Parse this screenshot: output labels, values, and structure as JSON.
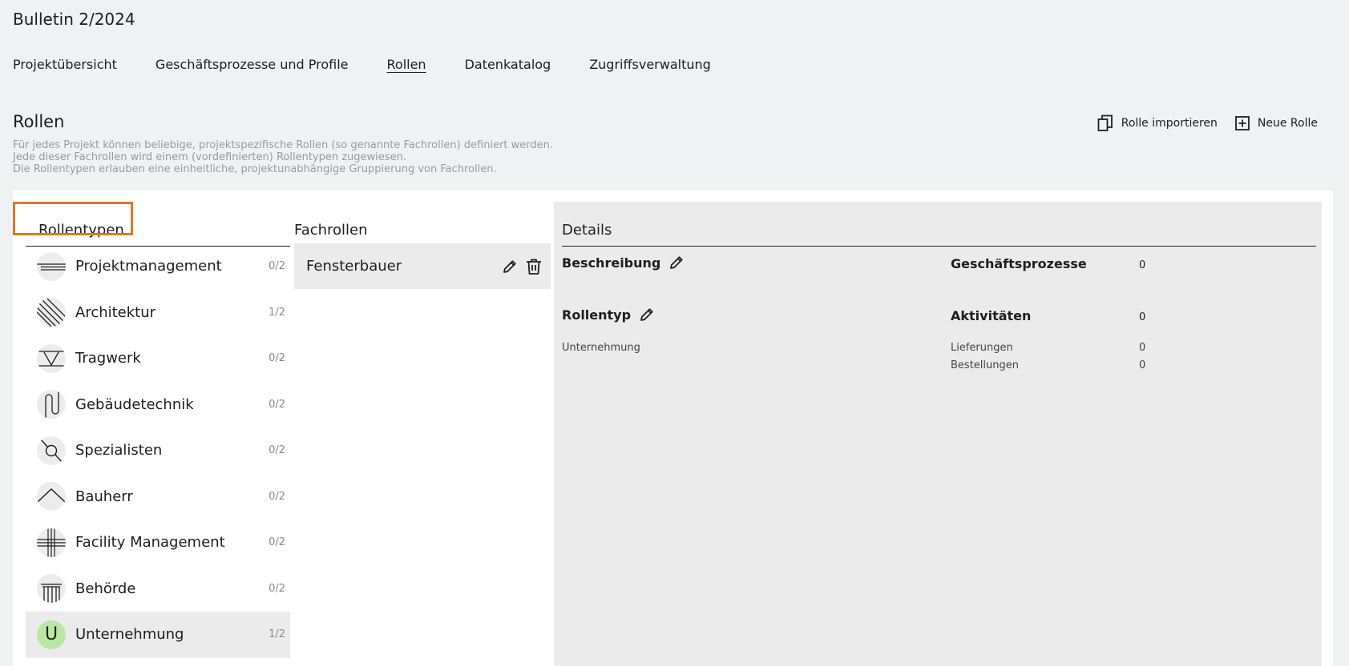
{
  "app": {
    "title": "Bulletin 2/2024"
  },
  "nav": {
    "items": [
      {
        "label": "Projektübersicht"
      },
      {
        "label": "Geschäftsprozesse und Profile"
      },
      {
        "label": "Rollen"
      },
      {
        "label": "Datenkatalog"
      },
      {
        "label": "Zugriffsverwaltung"
      }
    ],
    "active": "Rollen"
  },
  "section": {
    "title": "Rollen",
    "description": [
      "Für jedes Projekt können beliebige, projektspezifische Rollen (so genannte Fachrollen) definiert werden.",
      "Jede dieser Fachrollen wird einem (vordefinierten) Rollentypen zugewiesen.",
      "Die Rollentypen erlauben eine einheitliche, projektunabhängige Gruppierung von Fachrollen."
    ]
  },
  "actions": {
    "import_label": "Rolle importieren",
    "new_label": "Neue Rolle"
  },
  "rollentypen": {
    "header": "Rollentypen",
    "items": [
      {
        "label": "Projektmanagement",
        "count": "0/2",
        "icon": "lines-horizontal-icon"
      },
      {
        "label": "Architektur",
        "count": "1/2",
        "icon": "diagonal-lines-icon"
      },
      {
        "label": "Tragwerk",
        "count": "0/2",
        "icon": "triangle-icon"
      },
      {
        "label": "Gebäudetechnik",
        "count": "0/2",
        "icon": "pipe-loop-icon"
      },
      {
        "label": "Spezialisten",
        "count": "0/2",
        "icon": "magnifier-icon"
      },
      {
        "label": "Bauherr",
        "count": "0/2",
        "icon": "roof-icon"
      },
      {
        "label": "Facility Management",
        "count": "0/2",
        "icon": "grid-cross-icon"
      },
      {
        "label": "Behörde",
        "count": "0/2",
        "icon": "columns-icon"
      },
      {
        "label": "Unternehmung",
        "count": "1/2",
        "icon": "letter-u-icon",
        "icon_letter": "U"
      }
    ],
    "selected": "Unternehmung",
    "highlight_color": "#d97b1f",
    "selected_icon_color": "#b8e8a4"
  },
  "fachrollen": {
    "header": "Fachrollen",
    "items": [
      {
        "label": "Fensterbauer"
      }
    ]
  },
  "details": {
    "header": "Details",
    "beschreibung_label": "Beschreibung",
    "rollentyp_label": "Rollentyp",
    "rollentyp_value": "Unternehmung",
    "geschaeftsprozesse_label": "Geschäftsprozesse",
    "geschaeftsprozesse_value": "0",
    "aktivitaeten_label": "Aktivitäten",
    "aktivitaeten_value": "0",
    "lieferungen_label": "Lieferungen",
    "lieferungen_value": "0",
    "bestellungen_label": "Bestellungen",
    "bestellungen_value": "0"
  }
}
